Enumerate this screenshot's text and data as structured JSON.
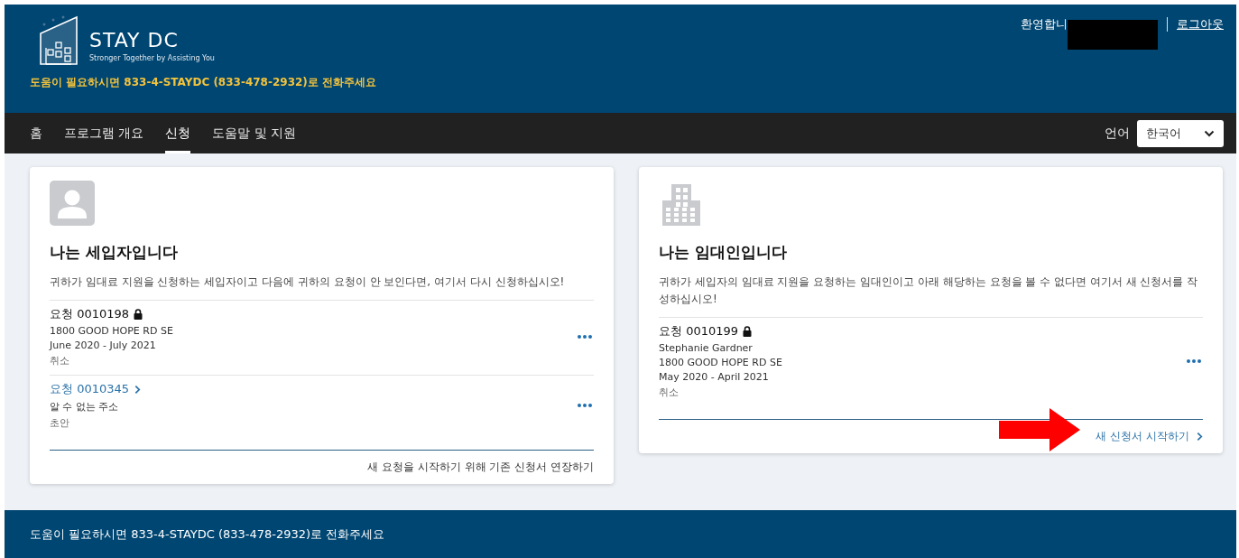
{
  "header": {
    "logo_title": "STAY DC",
    "logo_tagline": "Stronger Together by Assisting You",
    "helpline": "도움이 필요하시면 833-4-STAYDC (833-478-2932)로 전화주세요",
    "welcome": "환영합니",
    "logout": "로그아웃"
  },
  "nav": {
    "tabs": [
      {
        "label": "홈",
        "selected": false
      },
      {
        "label": "프로그램 개요",
        "selected": false
      },
      {
        "label": "신청",
        "selected": true
      },
      {
        "label": "도움말 및 지원",
        "selected": false
      }
    ],
    "language_label": "언어",
    "language_value": "한국어"
  },
  "cards": [
    {
      "kind": "person",
      "title": "나는 세입자입니다",
      "description": "귀하가 임대료 지원을 신청하는 세입자이고 다음에 귀하의 요청이 안 보인다면, 여기서 다시 신청하십시오!",
      "requests": [
        {
          "label": "요청",
          "number": "0010198",
          "locked": true,
          "lines": [
            "1800 GOOD HOPE RD SE",
            "June 2020 - July 2021"
          ],
          "status": "취소"
        },
        {
          "label": "요청",
          "number": "0010345",
          "locked": false,
          "lines": [
            "알 수 없는 주소"
          ],
          "status": "초안"
        }
      ],
      "footer_link": {
        "kind": "plain",
        "text": "새 요청을 시작하기 위해 기존 신청서 연장하기"
      }
    },
    {
      "kind": "building",
      "title": "나는 임대인입니다",
      "description": "귀하가 세입자의 임대료 지원을 요청하는 임대인이고 아래 해당하는 요청을 볼 수 없다면 여기서 새 신청서를 작성하십시오!",
      "requests": [
        {
          "label": "요청",
          "number": "0010199",
          "locked": true,
          "lines": [
            "Stephanie Gardner",
            "1800 GOOD HOPE RD SE",
            "May 2020 - April 2021"
          ],
          "status": "취소"
        }
      ],
      "footer_link": {
        "kind": "link",
        "text": "새 신청서 시작하기"
      }
    }
  ],
  "footer": {
    "helpline": "도움이 필요하시면 833-4-STAYDC (833-478-2932)로 전화주세요"
  }
}
